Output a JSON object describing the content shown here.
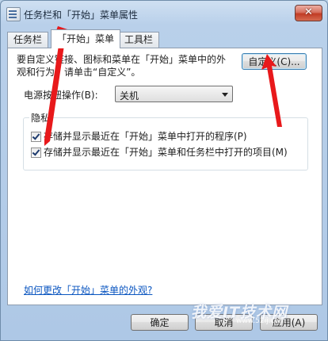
{
  "window": {
    "title": "任务栏和「开始」菜单属性",
    "close_label": "✕"
  },
  "tabs": [
    {
      "label": "任务栏",
      "active": false
    },
    {
      "label": "「开始」菜单",
      "active": true
    },
    {
      "label": "工具栏",
      "active": false
    }
  ],
  "start_menu": {
    "description": "要自定义链接、图标和菜单在「开始」菜单中的外观和行为，请单击“自定义”。",
    "customize_button": "自定义(C)...",
    "power_label": "电源按钮操作(B):",
    "power_value": "关机"
  },
  "privacy": {
    "title": "隐私",
    "items": [
      {
        "label": "存储并显示最近在「开始」菜单中打开的程序(P)",
        "checked": true
      },
      {
        "label": "存储并显示最近在「开始」菜单和任务栏中打开的项目(M)",
        "checked": true
      }
    ]
  },
  "help_link": "如何更改「开始」菜单的外观?",
  "buttons": {
    "ok": "确定",
    "cancel": "取消",
    "apply": "应用(A)"
  },
  "watermark": {
    "text": "我爱IT技术网",
    "url": "www.52ij.com"
  },
  "colors": {
    "arrow": "#e8191b",
    "link": "#0b56c0",
    "close": "#c13b24"
  }
}
